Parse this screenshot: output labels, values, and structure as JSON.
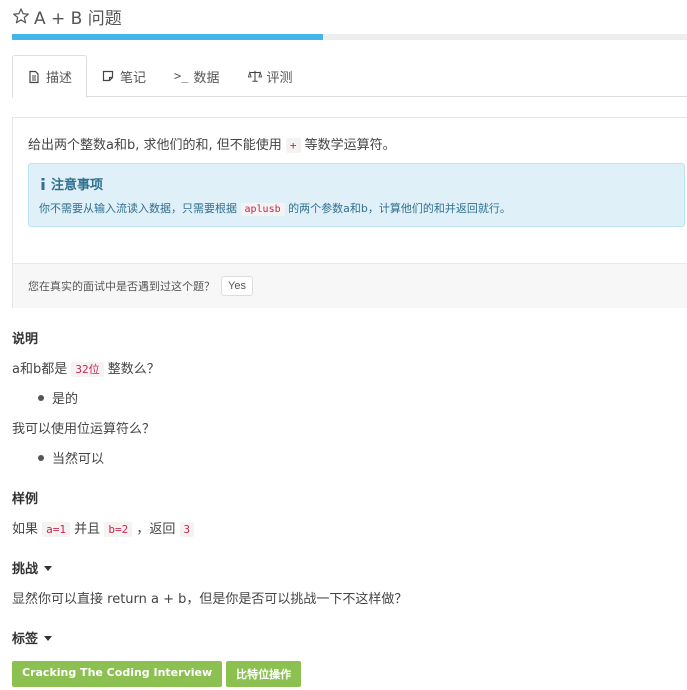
{
  "header": {
    "title": "A + B 问题",
    "progress": 0.46
  },
  "tabs": [
    {
      "label": "描述",
      "icon": "document-icon"
    },
    {
      "label": "笔记",
      "icon": "note-icon"
    },
    {
      "label": "数据",
      "icon": "terminal-icon"
    },
    {
      "label": "评测",
      "icon": "scale-icon"
    }
  ],
  "description": {
    "line_before": "给出两个整数a和b, 求他们的和, 但不能使用",
    "operator": "+",
    "line_after": "等数学运算符。",
    "notice": {
      "title": "注意事项",
      "before": "你不需要从输入流读入数据，只需要根据",
      "code": "aplusb",
      "after": "的两个参数a和b，计算他们的和并返回就行。"
    },
    "interview_question": "您在真实的面试中是否遇到过这个题？",
    "yes_label": "Yes"
  },
  "explanation": {
    "title": "说明",
    "q1_before": "a和b都是",
    "q1_code": "32位",
    "q1_after": "整数么？",
    "a1": "是的",
    "q2": "我可以使用位运算符么？",
    "a2": "当然可以"
  },
  "example": {
    "title": "样例",
    "prefix": "如果",
    "code_a": "a=1",
    "mid": "并且",
    "code_b": "b=2",
    "ret": "，返回",
    "code_ret": "3"
  },
  "challenge": {
    "title": "挑战",
    "text": "显然你可以直接 return a + b，但是你是否可以挑战一下不这样做？"
  },
  "tags_section": {
    "title": "标签",
    "tags": [
      "Cracking The Coding Interview",
      "比特位操作"
    ]
  }
}
